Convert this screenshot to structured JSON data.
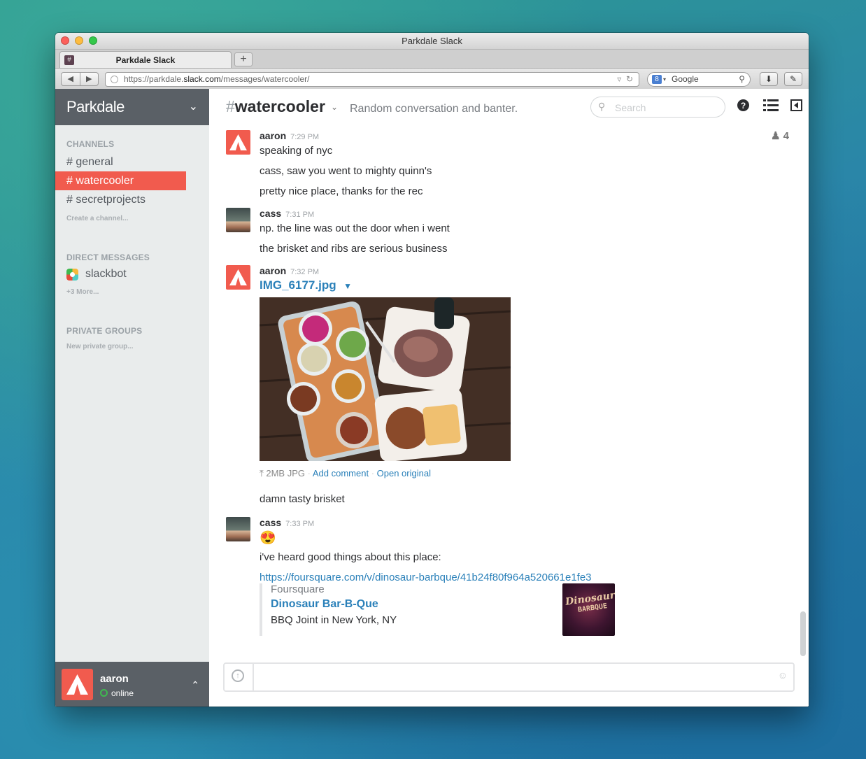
{
  "window": {
    "title": "Parkdale Slack"
  },
  "browser": {
    "tab_title": "Parkdale Slack",
    "new_tab_label": "+",
    "url_prefix": "https://parkdale.",
    "url_domain": "slack.com",
    "url_path": "/messages/watercooler/",
    "search_engine": "Google"
  },
  "sidebar": {
    "team_name": "Parkdale",
    "channels_title": "CHANNELS",
    "channels": [
      {
        "label": "# general",
        "active": false
      },
      {
        "label": "# watercooler",
        "active": true
      },
      {
        "label": "# secretprojects",
        "active": false
      }
    ],
    "create_channel": "Create a channel...",
    "dm_title": "DIRECT MESSAGES",
    "dms": [
      {
        "label": "slackbot"
      }
    ],
    "dm_more": "+3 More...",
    "groups_title": "PRIVATE GROUPS",
    "new_group": "New private group...",
    "user": {
      "name": "aaron",
      "status": "online"
    }
  },
  "channel": {
    "name": "watercooler",
    "hash": "#",
    "purpose": "Random conversation and banter.",
    "search_placeholder": "Search",
    "member_count": "4"
  },
  "messages": [
    {
      "author": "aaron",
      "time": "7:29 PM",
      "lines": [
        "speaking of nyc",
        "cass, saw you went to mighty quinn's",
        "pretty nice place, thanks for the rec"
      ]
    },
    {
      "author": "cass",
      "time": "7:31 PM",
      "lines": [
        "np. the line was out the door when i went",
        "the brisket and ribs are serious business"
      ]
    },
    {
      "author": "aaron",
      "time": "7:32 PM",
      "file": {
        "name": "IMG_6177.jpg",
        "meta": "2MB JPG",
        "add_comment": "Add comment",
        "open_original": "Open original"
      },
      "lines": [
        "damn tasty brisket"
      ]
    },
    {
      "author": "cass",
      "time": "7:33 PM",
      "emoji": "😍",
      "lines": [
        "i've heard good things about this place:"
      ],
      "link": "https://foursquare.com/v/dinosaur-barbque/41b24f80f964a520661e1fe3",
      "attachment": {
        "service": "Foursquare",
        "title": "Dinosaur Bar-B-Que",
        "text": "BBQ Joint in New York, NY",
        "thumb_line1": "Dinosaur",
        "thumb_line2": "BARBQUE"
      }
    }
  ],
  "colors": {
    "accent": "#f15b4e",
    "sidebar_dark": "#5a6066",
    "link": "#2a80b9",
    "sidebar_bg": "#e9ecec"
  }
}
